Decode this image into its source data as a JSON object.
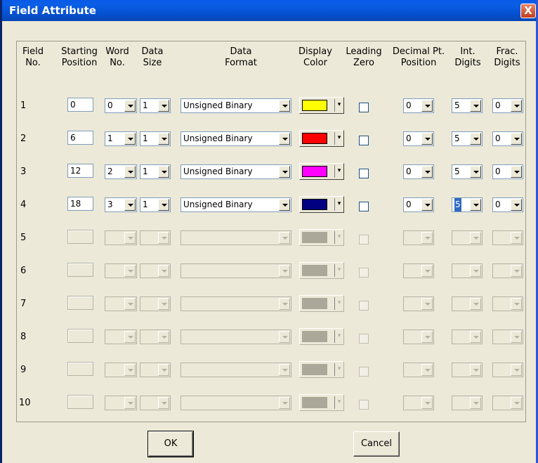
{
  "window": {
    "title": "Field Attribute",
    "close_glyph": "X"
  },
  "headers": {
    "field_no": [
      "Field",
      "No."
    ],
    "starting_position": [
      "Starting",
      "Position"
    ],
    "word_no": [
      "Word",
      "No."
    ],
    "data_size": [
      "Data",
      "Size"
    ],
    "data_format": [
      "Data",
      "Format"
    ],
    "display_color": [
      "Display",
      "Color"
    ],
    "leading_zero": [
      "Leading",
      "Zero"
    ],
    "decimal_pt_position": [
      "Decimal Pt.",
      "Position"
    ],
    "int_digits": [
      "Int.",
      "Digits"
    ],
    "frac_digits": [
      "Frac.",
      "Digits"
    ]
  },
  "rows": [
    {
      "no": "1",
      "start": "0",
      "word": "0",
      "size": "1",
      "format": "Unsigned Binary",
      "color": "#ffff00",
      "leading_zero": false,
      "decimal": "0",
      "int": "5",
      "frac": "0",
      "enabled": true
    },
    {
      "no": "2",
      "start": "6",
      "word": "1",
      "size": "1",
      "format": "Unsigned Binary",
      "color": "#ff0000",
      "leading_zero": false,
      "decimal": "0",
      "int": "5",
      "frac": "0",
      "enabled": true
    },
    {
      "no": "3",
      "start": "12",
      "word": "2",
      "size": "1",
      "format": "Unsigned Binary",
      "color": "#ff00ff",
      "leading_zero": false,
      "decimal": "0",
      "int": "5",
      "frac": "0",
      "enabled": true
    },
    {
      "no": "4",
      "start": "18",
      "word": "3",
      "size": "1",
      "format": "Unsigned Binary",
      "color": "#000080",
      "leading_zero": false,
      "decimal": "0",
      "int": "5",
      "frac": "0",
      "enabled": true,
      "int_selected": true
    },
    {
      "no": "5",
      "enabled": false
    },
    {
      "no": "6",
      "enabled": false
    },
    {
      "no": "7",
      "enabled": false
    },
    {
      "no": "8",
      "enabled": false
    },
    {
      "no": "9",
      "enabled": false
    },
    {
      "no": "10",
      "enabled": false
    }
  ],
  "buttons": {
    "ok": "OK",
    "cancel": "Cancel"
  },
  "colors": {
    "title_bar": "#0553d4",
    "dialog_bg": "#ece9d8",
    "selection": "#316ac5"
  }
}
